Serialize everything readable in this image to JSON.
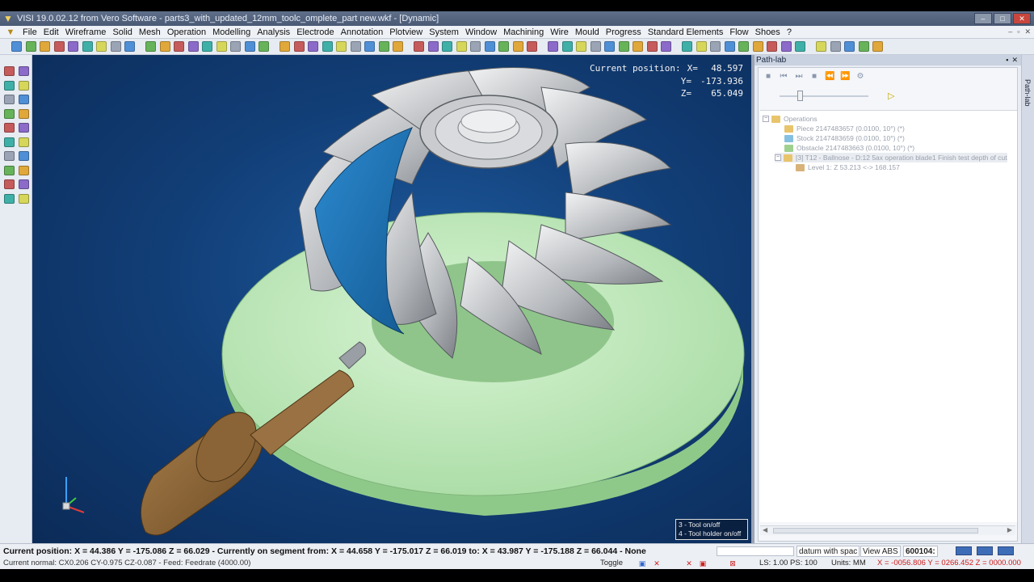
{
  "window": {
    "title": "VISI 19.0.02.12 from Vero Software - parts3_with_updated_12mm_toolc_omplete_part new.wkf - [Dynamic]",
    "min_label": "–",
    "max_label": "□",
    "close_label": "✕"
  },
  "menu": {
    "items": [
      "File",
      "Edit",
      "Wireframe",
      "Solid",
      "Mesh",
      "Operation",
      "Modelling",
      "Analysis",
      "Electrode",
      "Annotation",
      "Plotview",
      "System",
      "Window",
      "Machining",
      "Wire",
      "Mould",
      "Progress",
      "Standard Elements",
      "Flow",
      "Shoes",
      "?"
    ]
  },
  "viewport": {
    "coords": {
      "label": "Current position:",
      "x_label": "X=",
      "x": "48.597",
      "y_label": "Y=",
      "y": "-173.936",
      "z_label": "Z=",
      "z": "65.049"
    },
    "hint": {
      "line1": "3 - Tool on/off",
      "line2": "4 - Tool holder on/off"
    },
    "colors": {
      "background": "#123f78",
      "stock_disc": "#bfe8bf",
      "blade": "#b9bcc0",
      "highlight_blade": "#1f6fb0",
      "tool": "#8a6436"
    }
  },
  "pathlab": {
    "title": "Path-lab",
    "tab_label": "Path-lab",
    "tree": {
      "operations": "Operations",
      "piece": "Piece 2147483657 (0.0100, 10°) (*)",
      "stock": "Stock 2147483659 (0.0100, 10°) (*)",
      "obstacle": "Obstacle 2147483663 (0.0100, 10°) (*)",
      "tool_op": "[3] T12 - Ballnose - D:12 5ax operation blade1 Finish test depth of cut",
      "level": "Level 1: Z 53.213 <-> 168.157"
    }
  },
  "status": {
    "line1": "Current position: X = 44.386 Y = -175.086 Z = 66.029 - Currently on segment from: X = 44.658 Y = -175.017 Z = 66.019 to: X = 43.987 Y = -175.188 Z = 66.044 - None",
    "line2": "Current normal: CX0.206 CY-0.975 CZ-0.087 - Feed: Feedrate (4000.00)",
    "datum": "datum with spac",
    "view": "View ABS",
    "code": "600104:",
    "toggle": "Toggle",
    "ls_ps": "LS: 1.00 PS: 100",
    "units": "Units: MM",
    "xy": "X = -0056.806 Y = 0266.452 Z = 0000.000"
  }
}
